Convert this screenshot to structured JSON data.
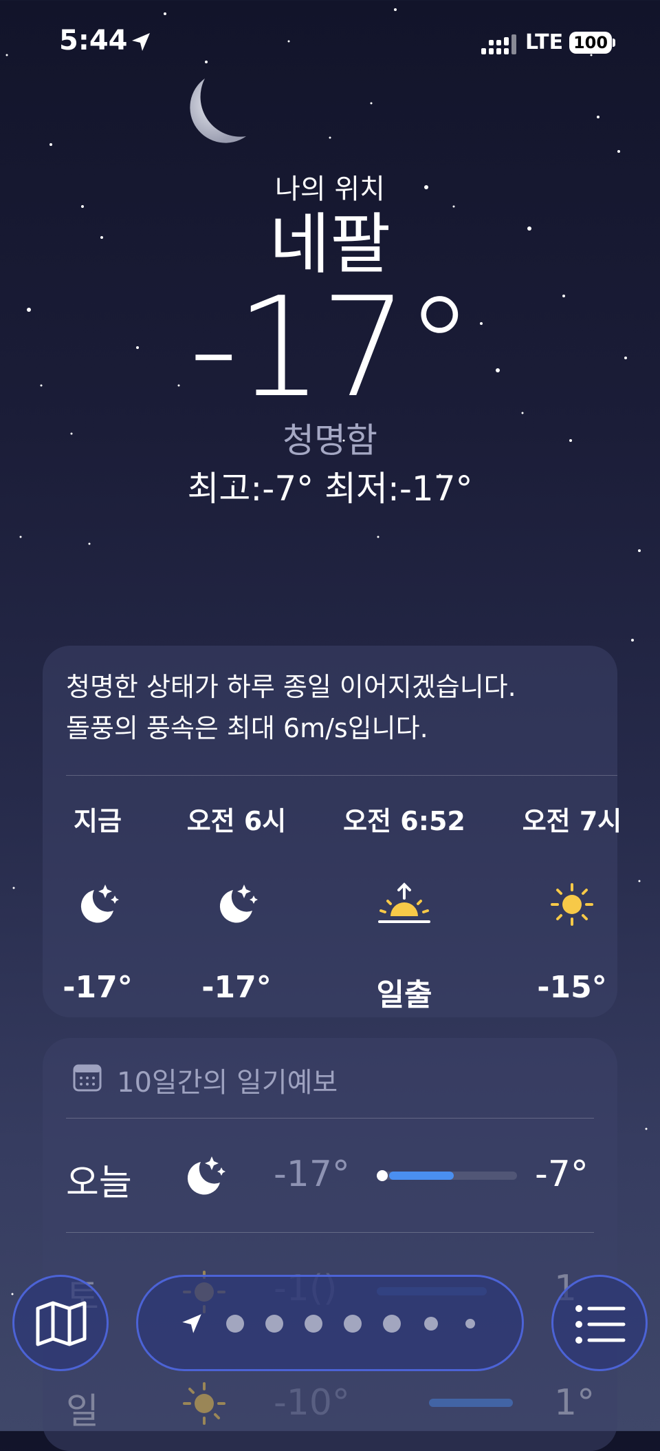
{
  "status_bar": {
    "time": "5:44",
    "network": "LTE",
    "battery": "100"
  },
  "hero": {
    "my_location": "나의 위치",
    "city": "네팔",
    "temperature": "-17°",
    "condition": "청명함",
    "high_low": "최고:-7°  최저:-17°"
  },
  "hourly": {
    "summary_line1": "청명한 상태가 하루 종일 이어지겠습니다.",
    "summary_line2": "돌풍의 풍속은 최대 6m/s입니다.",
    "items": [
      {
        "label": "지금",
        "icon": "moon-stars-icon",
        "value": "-17°"
      },
      {
        "label": "오전 6시",
        "icon": "moon-stars-icon",
        "value": "-17°"
      },
      {
        "label": "오전 6:52",
        "icon": "sunrise-icon",
        "value": "일출"
      },
      {
        "label": "오전 7시",
        "icon": "sun-icon",
        "value": "-15°"
      }
    ]
  },
  "daily": {
    "title": "10일간의 일기예보",
    "rows": [
      {
        "day": "오늘",
        "icon": "moon-stars-icon",
        "low": "-17°",
        "high": "-7°"
      },
      {
        "day": "토",
        "icon": "sun-icon",
        "low": "-1()",
        "high": "1"
      },
      {
        "day": "일",
        "icon": "sun-icon",
        "low": "-10°",
        "high": "1°"
      }
    ]
  },
  "toolbar": {
    "map_icon": "map-icon",
    "location_icon": "location-arrow-icon",
    "list_icon": "list-icon"
  },
  "colors": {
    "accent": "#4a8ff0",
    "sun": "#f7c948",
    "toolbar_border": "#4c63d6"
  }
}
